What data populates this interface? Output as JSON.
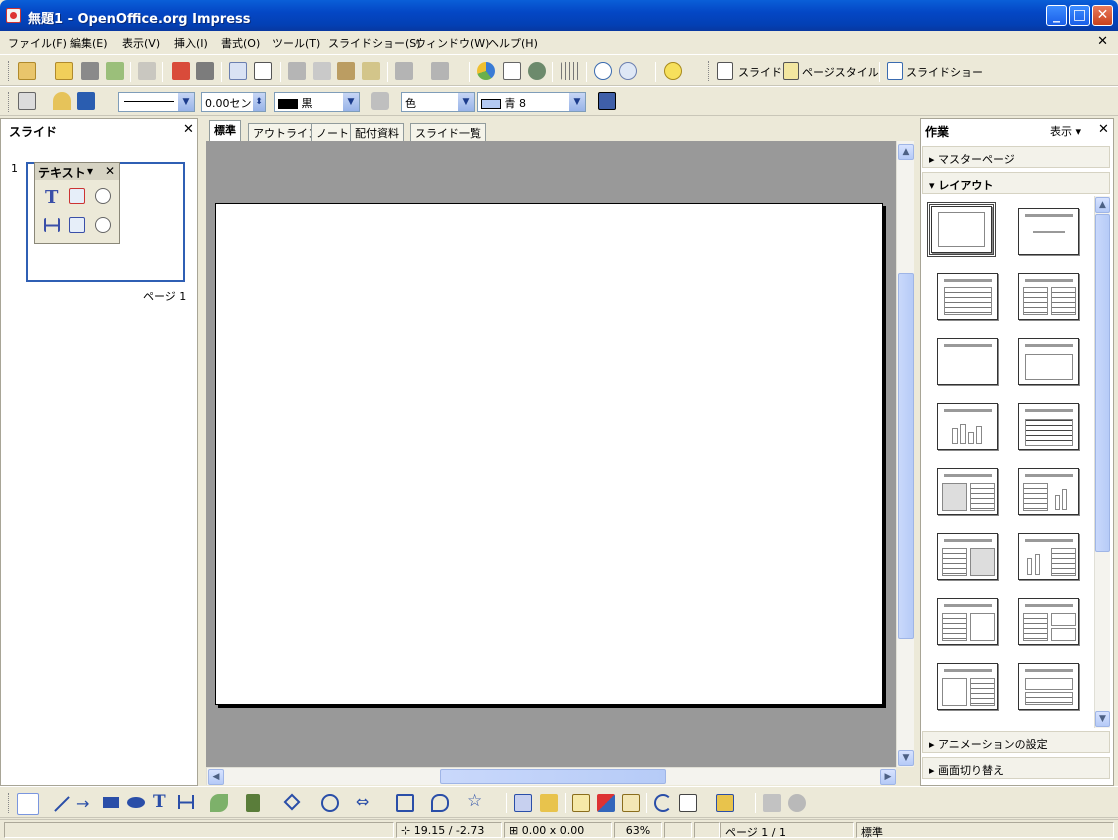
{
  "window": {
    "title": "無題1 - OpenOffice.org Impress",
    "minimize": "_",
    "maximize": "□",
    "close": "✕"
  },
  "menu": [
    "ファイル(F)",
    "編集(E)",
    "表示(V)",
    "挿入(I)",
    "書式(O)",
    "ツール(T)",
    "スライドショー(S)",
    "ウィンドウ(W)",
    "ヘルプ(H)"
  ],
  "menu_close": "✕",
  "toolbar1": {
    "slide_btn": "スライド",
    "page_style_btn": "ページスタイル",
    "slideshow_btn": "スライドショー"
  },
  "toolbar2": {
    "line_width": "0.00セン",
    "line_color": "黒",
    "area_style": "色",
    "area_color": "青 8"
  },
  "slides_pane": {
    "title": "スライド",
    "close": "✕",
    "slide_number": "1",
    "page_label": "ページ 1"
  },
  "text_toolbar": {
    "title": "テキスト",
    "menu": "▾",
    "close": "✕"
  },
  "tabs": [
    "標準",
    "アウトライン",
    "ノート",
    "配付資料",
    "スライド一覧"
  ],
  "active_tab": "標準",
  "task_pane": {
    "title": "作業",
    "view_menu": "表示 ▾",
    "close": "✕",
    "sections": {
      "master": "マスターページ",
      "layout": "レイアウト",
      "animation": "アニメーションの設定",
      "transition": "画面切り替え"
    }
  },
  "status": {
    "position": "19.15 / -2.73",
    "size": "0.00 x 0.00",
    "zoom": "63%",
    "page": "ページ 1 / 1",
    "style": "標準"
  },
  "colors": {
    "titlebar": "#0447c5",
    "chrome": "#ece9d8",
    "canvas": "#999999",
    "accent": "#2f5fb4"
  }
}
